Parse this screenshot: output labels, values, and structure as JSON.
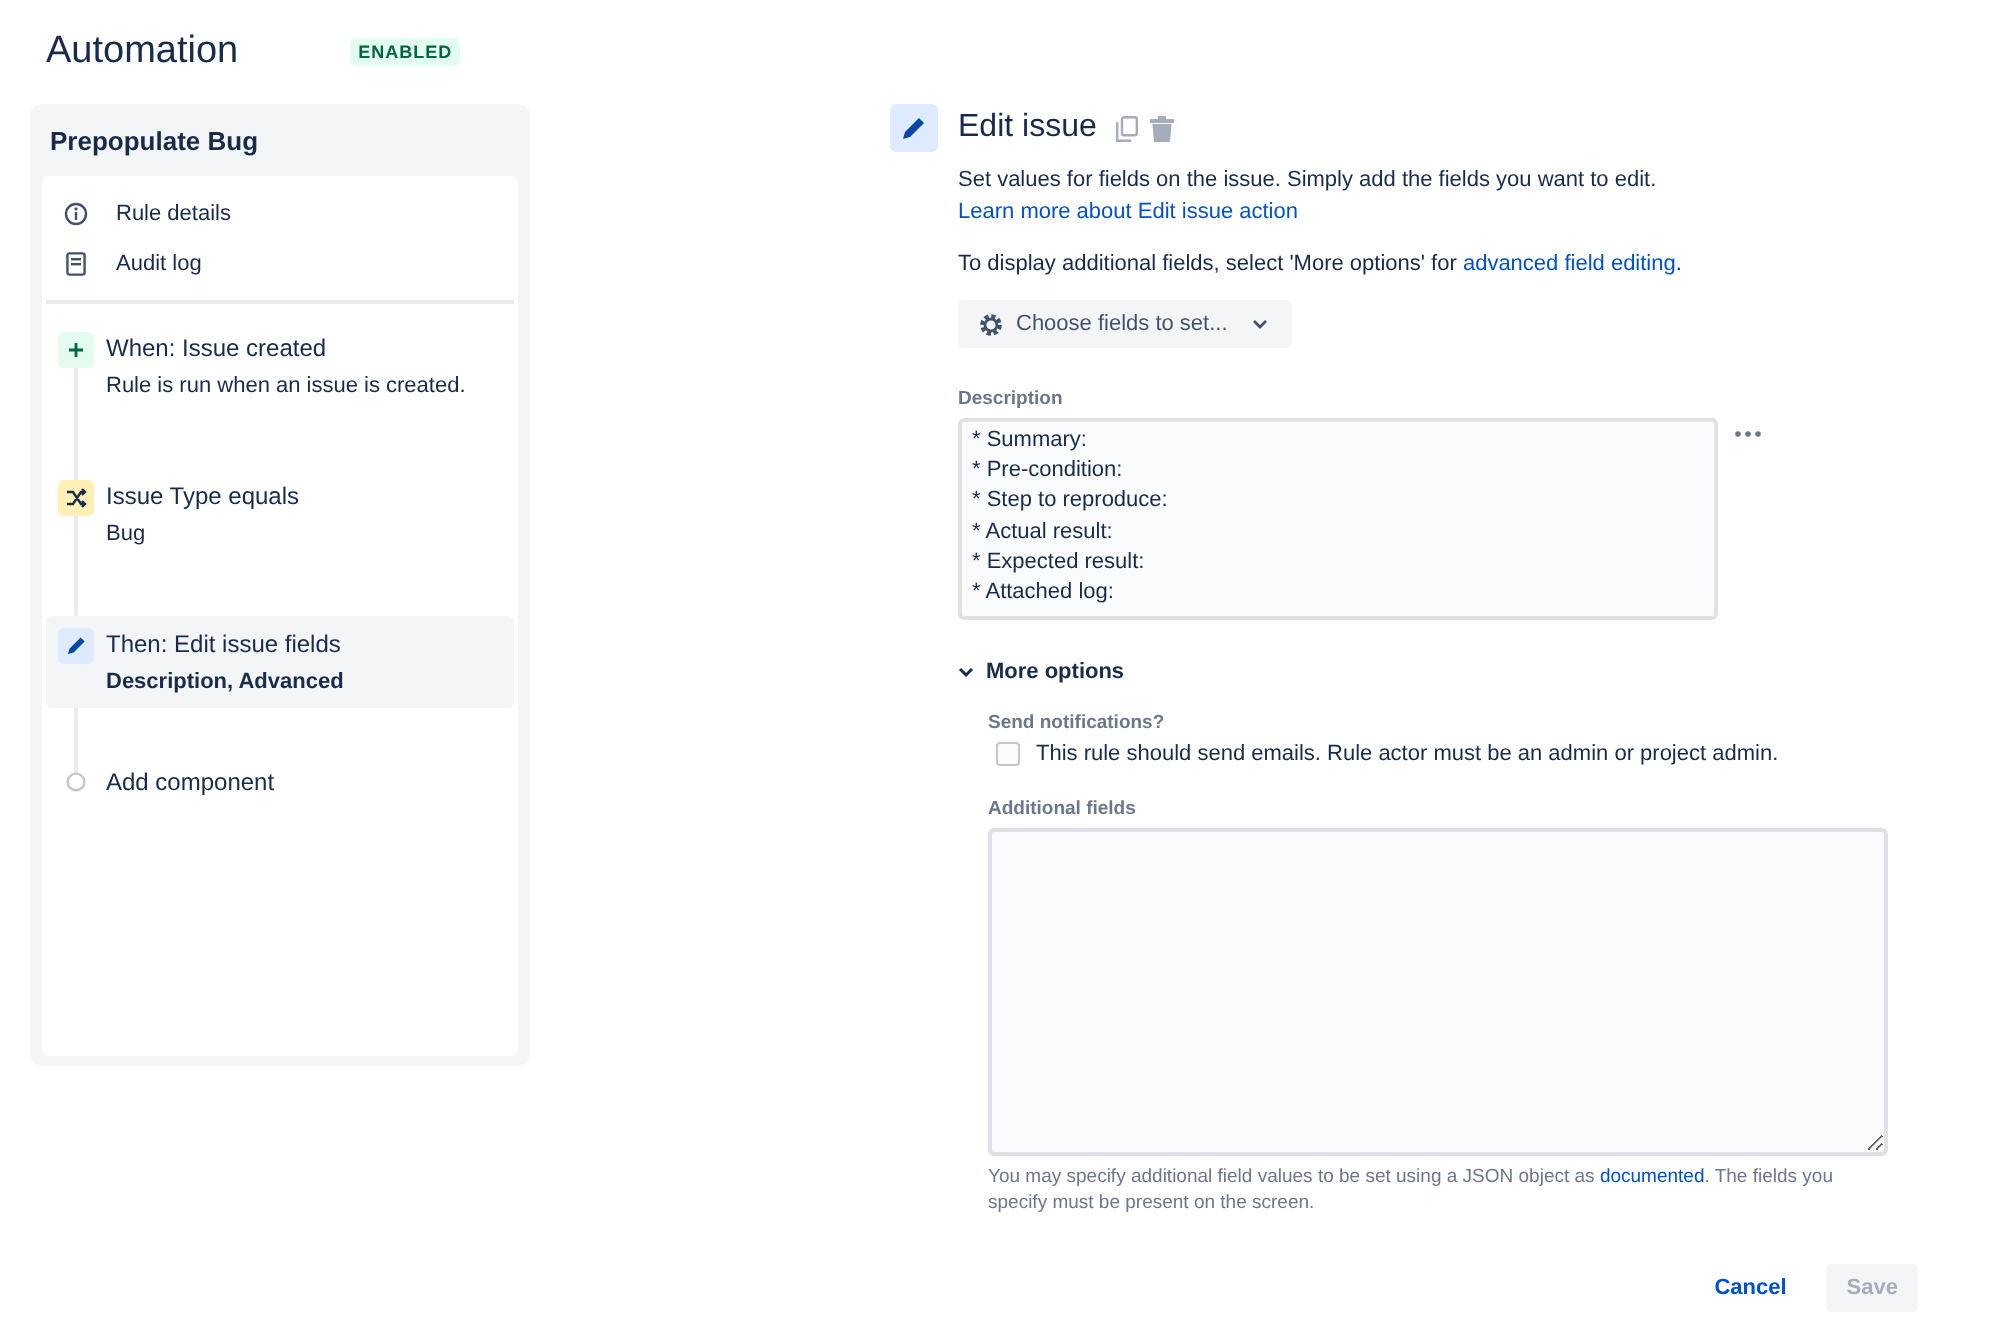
{
  "header": {
    "title": "Automation",
    "status": "ENABLED"
  },
  "sidebar": {
    "title": "Prepopulate Bug",
    "links": [
      {
        "kind": "info",
        "label": "Rule details"
      },
      {
        "kind": "log",
        "label": "Audit log"
      }
    ],
    "steps": [
      {
        "kind": "trigger",
        "title": "When: Issue created",
        "detail": "Rule is run when an issue is created.",
        "selected": false
      },
      {
        "kind": "condition",
        "title": "Issue Type equals",
        "detail": "Bug",
        "selected": false
      },
      {
        "kind": "action",
        "title": "Then: Edit issue fields",
        "detail": "Description, Advanced",
        "selected": true
      }
    ],
    "add_component": "Add component"
  },
  "editor": {
    "title": "Edit issue",
    "intro": {
      "text": "Set values for fields on the issue. Simply add the fields you want to edit. ",
      "link": "Learn more about Edit issue action"
    },
    "hint": {
      "text": "To display additional fields, select 'More options' for ",
      "link": "advanced field editing",
      "after": "."
    },
    "choose_button": "Choose fields to set...",
    "description": {
      "label": "Description",
      "lines": [
        "* Summary:",
        "* Pre-condition:",
        "* Step to reproduce:",
        "* Actual result:",
        "* Expected result:",
        "* Attached log:"
      ]
    },
    "more_options": {
      "label": "More options",
      "expanded": true
    },
    "notifications": {
      "label": "Send notifications?",
      "checkbox": "This rule should send emails. Rule actor must be an admin or project admin.",
      "checked": false
    },
    "additional": {
      "label": "Additional fields",
      "help": {
        "text": "You may specify additional field values to be set using a JSON object as ",
        "link": "documented",
        "after": ". The fields you specify must be present on the screen."
      }
    },
    "buttons": [
      {
        "kind": "link",
        "label": "Cancel",
        "disabled": false
      },
      {
        "kind": "primary",
        "label": "Save",
        "disabled": true
      }
    ]
  }
}
